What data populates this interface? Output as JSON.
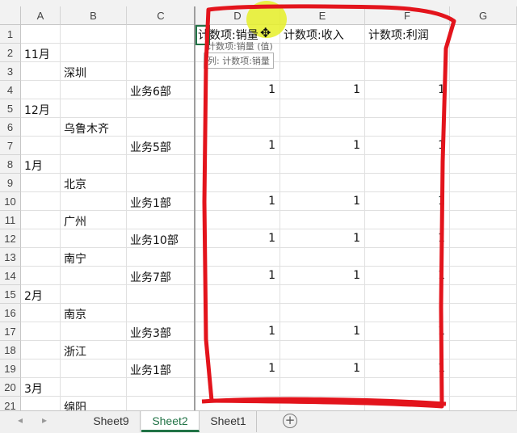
{
  "columns": [
    "A",
    "B",
    "C",
    "D",
    "E",
    "F",
    "G"
  ],
  "rows": [
    "1",
    "2",
    "3",
    "4",
    "5",
    "6",
    "7",
    "8",
    "9",
    "10",
    "11",
    "12",
    "13",
    "14",
    "15",
    "16",
    "17",
    "18",
    "19",
    "20",
    "21"
  ],
  "headers": {
    "d1": "计数项:销量",
    "e1": "计数项:收入",
    "f1": "计数项:利润"
  },
  "tooltip": {
    "ghost_text": "计数项:销量 (值)",
    "column_tip": "列: 计数项:销量"
  },
  "pivot_rows": [
    {
      "level": 1,
      "label": "11月"
    },
    {
      "level": 2,
      "label": "深圳"
    },
    {
      "level": 3,
      "label": "业务6部",
      "d": "1",
      "e": "1",
      "f": "1"
    },
    {
      "level": 1,
      "label": "12月"
    },
    {
      "level": 2,
      "label": "乌鲁木齐"
    },
    {
      "level": 3,
      "label": "业务5部",
      "d": "1",
      "e": "1",
      "f": "1"
    },
    {
      "level": 1,
      "label": "1月"
    },
    {
      "level": 2,
      "label": "北京"
    },
    {
      "level": 3,
      "label": "业务1部",
      "d": "1",
      "e": "1",
      "f": "1"
    },
    {
      "level": 2,
      "label": "广州"
    },
    {
      "level": 3,
      "label": "业务10部",
      "d": "1",
      "e": "1",
      "f": "1"
    },
    {
      "level": 2,
      "label": "南宁"
    },
    {
      "level": 3,
      "label": "业务7部",
      "d": "1",
      "e": "1",
      "f": "1"
    },
    {
      "level": 1,
      "label": "2月"
    },
    {
      "level": 2,
      "label": "南京"
    },
    {
      "level": 3,
      "label": "业务3部",
      "d": "1",
      "e": "1",
      "f": "1"
    },
    {
      "level": 2,
      "label": "浙江"
    },
    {
      "level": 3,
      "label": "业务1部",
      "d": "1",
      "e": "1",
      "f": "1"
    },
    {
      "level": 1,
      "label": "3月"
    },
    {
      "level": 2,
      "label": "绵阳"
    }
  ],
  "sheet_tabs": [
    {
      "label": "Sheet9",
      "active": false
    },
    {
      "label": "Sheet2",
      "active": true
    },
    {
      "label": "Sheet1",
      "active": false
    }
  ],
  "add_sheet_label": "+",
  "colors": {
    "accent": "#217346",
    "annotation": "#e3141c",
    "highlight": "#e6f028"
  }
}
